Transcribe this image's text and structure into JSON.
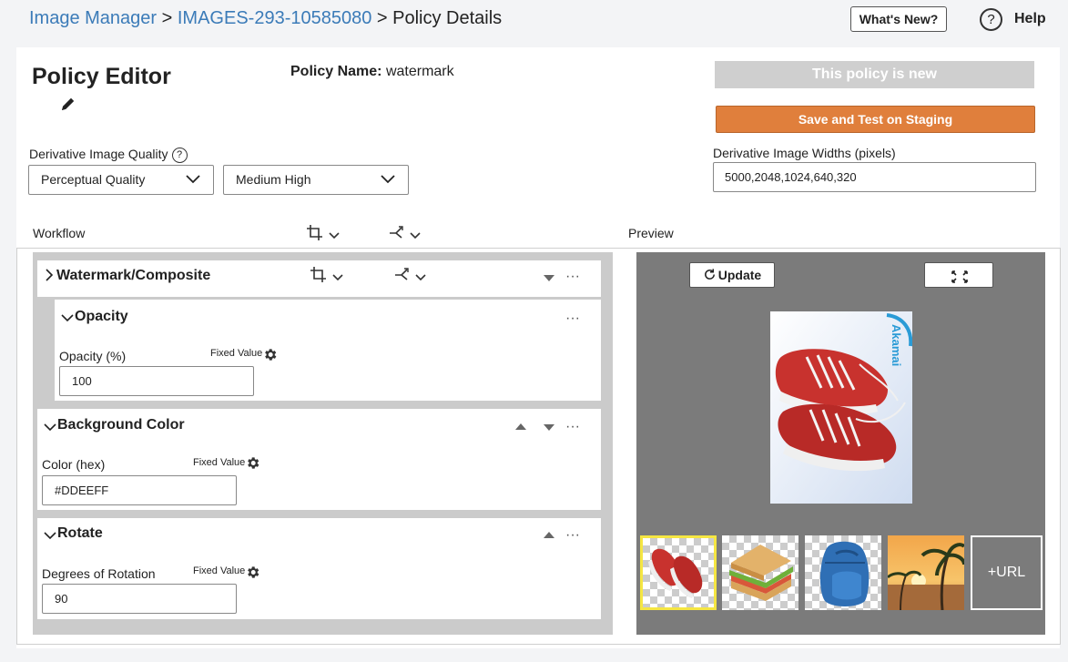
{
  "breadcrumb": {
    "item1": "Image Manager",
    "sep1": " > ",
    "item2": "IMAGES-293-10585080",
    "sep2": " > ",
    "current": "Policy Details"
  },
  "header": {
    "whats_new": "What's New?",
    "help_icon": "?",
    "help_label": "Help"
  },
  "editor": {
    "title": "Policy Editor",
    "edit_icon": "pencil-icon",
    "policy_name_label": "Policy Name:",
    "policy_name_value": "watermark",
    "status_badge": "This policy is new",
    "save_button": "Save and Test on Staging"
  },
  "quality": {
    "label": "Derivative Image Quality",
    "help_icon": "?",
    "mode": "Perceptual Quality",
    "level": "Medium High"
  },
  "widths": {
    "label": "Derivative Image Widths (pixels)",
    "value": "5000,2048,1024,640,320"
  },
  "workflow": {
    "label": "Workflow",
    "tools": [
      "crop-icon",
      "transform-icon"
    ],
    "composite": {
      "title": "Watermark/Composite",
      "more": "···"
    },
    "opacity": {
      "title": "Opacity",
      "field_label": "Opacity (%)",
      "fixed_label": "Fixed Value",
      "value": "100",
      "more": "···"
    },
    "background": {
      "title": "Background Color",
      "field_label": "Color (hex)",
      "fixed_label": "Fixed Value",
      "value": "#DDEEFF",
      "more": "···"
    },
    "rotate": {
      "title": "Rotate",
      "field_label": "Degrees of Rotation",
      "fixed_label": "Fixed Value",
      "value": "90",
      "more": "···"
    }
  },
  "preview": {
    "label": "Preview",
    "update_button": "Update",
    "logo_text": "Akamai",
    "add_url": "+URL",
    "thumbnails": [
      "sneakers",
      "sandwich",
      "backpack",
      "beach"
    ],
    "selected_color": "#f5e642"
  },
  "colors": {
    "link": "#3b7bb8",
    "save_button": "#e07f3c",
    "badge": "#cfcfcf",
    "preview_bg": "#7b7b7b"
  }
}
